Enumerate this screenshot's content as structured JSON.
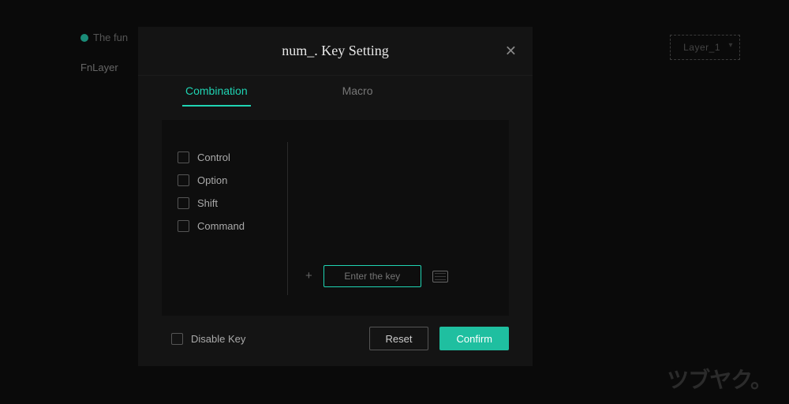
{
  "background": {
    "notice": "The fun",
    "layer_label": "FnLayer",
    "layer_select": "Layer_1"
  },
  "modal": {
    "title": "num_. Key Setting",
    "tabs": {
      "combination": "Combination",
      "macro": "Macro"
    },
    "modifiers": {
      "control": "Control",
      "option": "Option",
      "shift": "Shift",
      "command": "Command"
    },
    "key_placeholder": "Enter the key",
    "disable": "Disable Key",
    "reset": "Reset",
    "confirm": "Confirm"
  },
  "watermark": "ツブヤク。"
}
